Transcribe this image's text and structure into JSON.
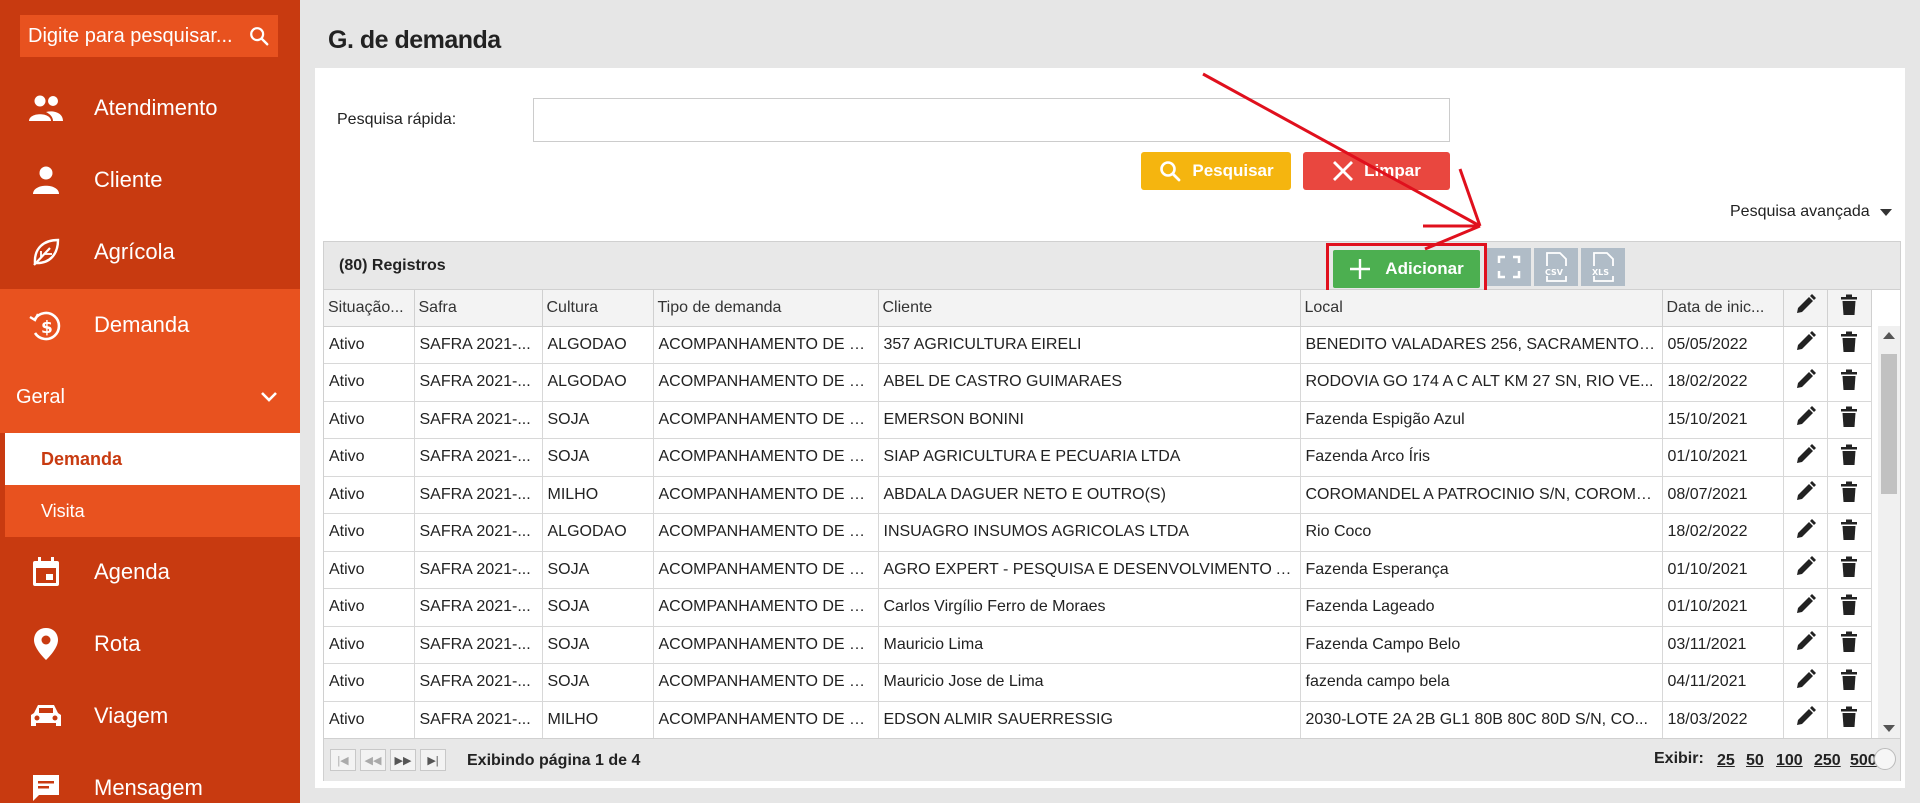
{
  "sidebar": {
    "search_placeholder": "Digite para pesquisar...",
    "items": [
      {
        "label": "Atendimento",
        "icon": "people-icon"
      },
      {
        "label": "Cliente",
        "icon": "person-icon"
      },
      {
        "label": "Agrícola",
        "icon": "leaf-icon"
      },
      {
        "label": "Demanda",
        "icon": "dollar-history-icon"
      }
    ],
    "group": {
      "label": "Geral",
      "sub_items": [
        "Demanda",
        "Visita"
      ],
      "selected": "Demanda"
    },
    "items_after": [
      {
        "label": "Agenda",
        "icon": "calendar-icon"
      },
      {
        "label": "Rota",
        "icon": "location-pin-icon"
      },
      {
        "label": "Viagem",
        "icon": "car-icon"
      },
      {
        "label": "Mensagem",
        "icon": "message-icon"
      }
    ]
  },
  "main": {
    "title": "G. de demanda",
    "quick_search_label": "Pesquisa rápida:",
    "quick_search_value": "",
    "search_button": "Pesquisar",
    "clear_button": "Limpar",
    "advanced_search": "Pesquisa avançada"
  },
  "grid": {
    "records": "(80) Registros",
    "add_button": "Adicionar",
    "csv_label": "CSV",
    "xls_label": "XLS",
    "columns": [
      "Situação...",
      "Safra",
      "Cultura",
      "Tipo de demanda",
      "Cliente",
      "Local",
      "Data de inic..."
    ],
    "rows": [
      [
        "Ativo",
        "SAFRA 2021-...",
        "ALGODAO",
        "ACOMPANHAMENTO DE C...",
        "357 AGRICULTURA EIRELI",
        "BENEDITO VALADARES 256, SACRAMENTO, ...",
        "05/05/2022"
      ],
      [
        "Ativo",
        "SAFRA 2021-...",
        "ALGODAO",
        "ACOMPANHAMENTO DE C...",
        "ABEL DE CASTRO GUIMARAES",
        "RODOVIA GO 174 A C ALT KM 27 SN, RIO VE...",
        "18/02/2022"
      ],
      [
        "Ativo",
        "SAFRA 2021-...",
        "SOJA",
        "ACOMPANHAMENTO DE C...",
        "EMERSON BONINI",
        "Fazenda Espigão Azul",
        "15/10/2021"
      ],
      [
        "Ativo",
        "SAFRA 2021-...",
        "SOJA",
        "ACOMPANHAMENTO DE C...",
        "SIAP AGRICULTURA E PECUARIA LTDA",
        "Fazenda Arco Íris",
        "01/10/2021"
      ],
      [
        "Ativo",
        "SAFRA 2021-...",
        "MILHO",
        "ACOMPANHAMENTO DE C...",
        "ABDALA DAGUER NETO E OUTRO(S)",
        "COROMANDEL A PATROCINIO S/N, COROMA...",
        "08/07/2021"
      ],
      [
        "Ativo",
        "SAFRA 2021-...",
        "ALGODAO",
        "ACOMPANHAMENTO DE C...",
        "INSUAGRO INSUMOS AGRICOLAS LTDA",
        "Rio Coco",
        "18/02/2022"
      ],
      [
        "Ativo",
        "SAFRA 2021-...",
        "SOJA",
        "ACOMPANHAMENTO DE C...",
        "AGRO EXPERT - PESQUISA E DESENVOLVIMENTO AG...",
        "Fazenda Esperança",
        "01/10/2021"
      ],
      [
        "Ativo",
        "SAFRA 2021-...",
        "SOJA",
        "ACOMPANHAMENTO DE C...",
        "Carlos Virgílio Ferro de Moraes",
        "Fazenda Lageado",
        "01/10/2021"
      ],
      [
        "Ativo",
        "SAFRA 2021-...",
        "SOJA",
        "ACOMPANHAMENTO DE C...",
        "Mauricio Lima",
        "Fazenda Campo Belo",
        "03/11/2021"
      ],
      [
        "Ativo",
        "SAFRA 2021-...",
        "SOJA",
        "ACOMPANHAMENTO DE C...",
        "Mauricio Jose de Lima",
        "fazenda campo bela",
        "04/11/2021"
      ],
      [
        "Ativo",
        "SAFRA 2021-...",
        "MILHO",
        "ACOMPANHAMENTO DE C...",
        "EDSON ALMIR SAUERRESSIG",
        "2030-LOTE 2A 2B GL1 80B 80C 80D S/N, CO...",
        "18/03/2022"
      ]
    ],
    "footer": {
      "page_info": "Exibindo página 1 de 4",
      "show_label": "Exibir:",
      "page_sizes": [
        "25",
        "50",
        "100",
        "250",
        "500"
      ]
    }
  },
  "colors": {
    "sidebar_bg": "#c83a10",
    "sidebar_active": "#e8521f",
    "add_green": "#4caf50",
    "search_yellow": "#f5b50f",
    "clear_red": "#e9473f",
    "annotation_red": "#e0101d"
  }
}
